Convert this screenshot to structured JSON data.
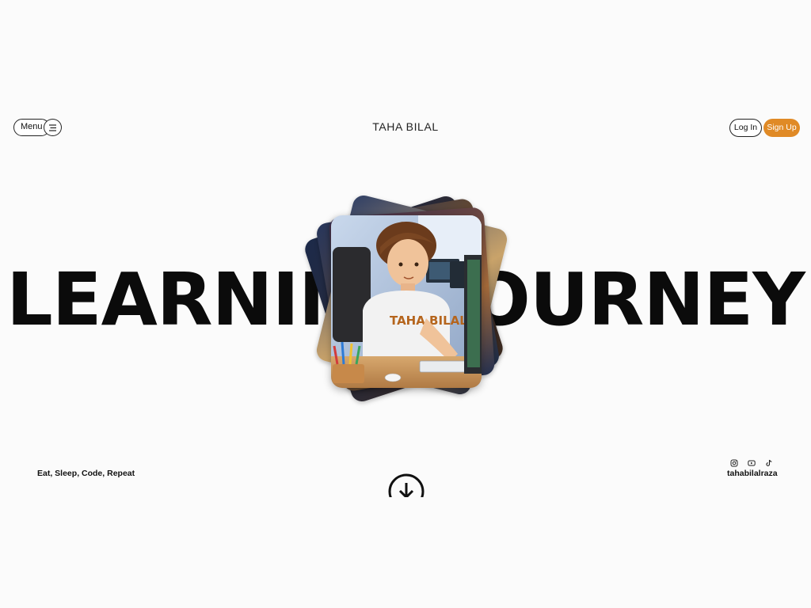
{
  "header": {
    "menu_label": "Menu",
    "menu_icon": "hamburger-icon",
    "brand": "TAHA BILAL",
    "login_label": "Log In",
    "signup_label": "Sign Up",
    "accent_color": "#e08a26"
  },
  "hero": {
    "title": "LEARNING JOURNEY",
    "image_shirt_text": "TAHA BILAL"
  },
  "footer": {
    "tagline": "Eat, Sleep, Code, Repeat",
    "handle": "tahabilalraza",
    "social_icons": [
      "instagram-icon",
      "youtube-icon",
      "tiktok-icon"
    ],
    "scroll_icon": "arrow-down-circle-icon"
  }
}
